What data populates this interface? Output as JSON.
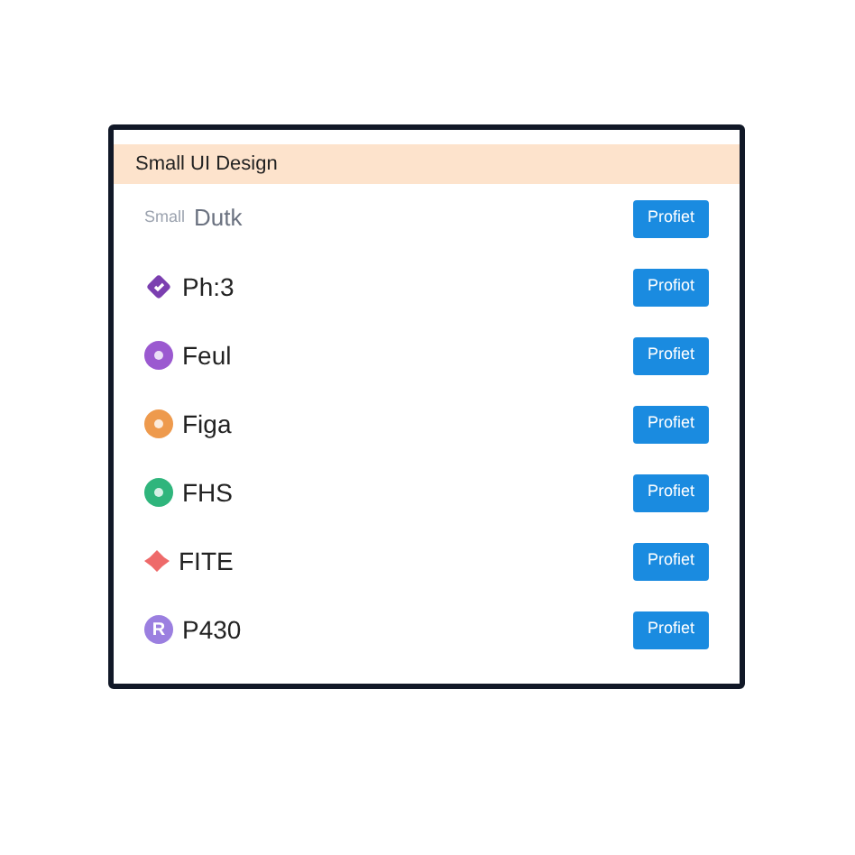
{
  "header": {
    "title": "Small UI Design"
  },
  "rows": [
    {
      "kind": "prefixed",
      "prefix": "Small",
      "name": "Dutk",
      "button": "Profiet"
    },
    {
      "kind": "diamond",
      "color": "#7b3fb0",
      "name": "Ph:3",
      "button": "Profiot"
    },
    {
      "kind": "circle",
      "color": "#9b59d0",
      "name": "Feul",
      "button": "Profiet"
    },
    {
      "kind": "circle",
      "color": "#ee9a4d",
      "name": "Figa",
      "button": "Profiet"
    },
    {
      "kind": "circle",
      "color": "#2fb57c",
      "name": "FHS",
      "button": "Profiet"
    },
    {
      "kind": "flower",
      "color": "#ee6a6a",
      "name": "FITE",
      "button": "Profiet"
    },
    {
      "kind": "letter",
      "color": "#9b7fe0",
      "letter": "R",
      "name": "P430",
      "button": "Profiet"
    }
  ]
}
